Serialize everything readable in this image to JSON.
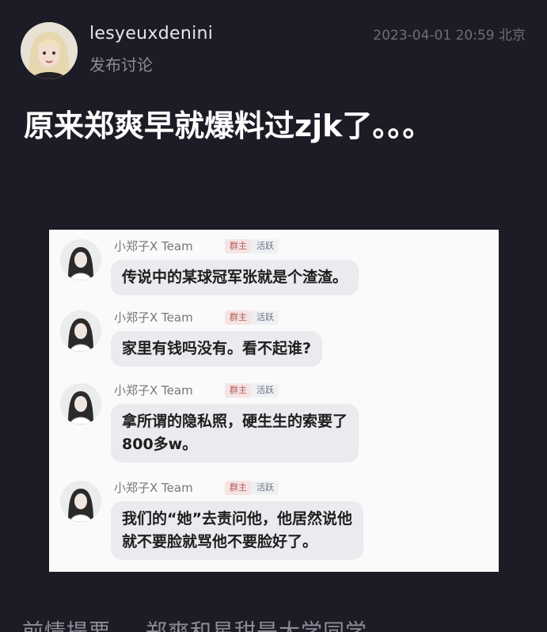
{
  "post": {
    "username": "lesyeuxdenini",
    "subtitle": "发布讨论",
    "timestamp": "2023-04-01 20:59 北京",
    "title": "原来郑爽早就爆料过zjk了。。。"
  },
  "chat_screenshot": {
    "messages": [
      {
        "name": "小郑子X Team",
        "badge_role": "群主",
        "badge_active": "活跃",
        "lines": [
          "传说中的某球冠军张就是个渣渣。"
        ]
      },
      {
        "name": "小郑子X Team",
        "badge_role": "群主",
        "badge_active": "活跃",
        "lines": [
          "家里有钱吗没有。看不起谁?"
        ]
      },
      {
        "name": "小郑子X Team",
        "badge_role": "群主",
        "badge_active": "活跃",
        "lines": [
          "拿所谓的隐私照，硬生生的索要了",
          "800多w。"
        ]
      },
      {
        "name": "小郑子X Team",
        "badge_role": "群主",
        "badge_active": "活跃",
        "lines": [
          "我们的“她”去责问他，他居然说他",
          "就不要脸就骂他不要脸好了。"
        ]
      }
    ]
  },
  "footer": {
    "text_left": "前情提要",
    "text_right": "郑爽和星甜是大学同学"
  }
}
